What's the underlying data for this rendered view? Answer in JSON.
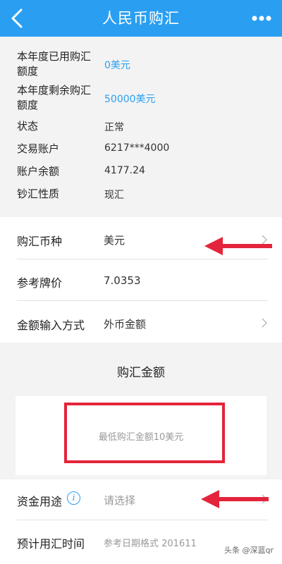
{
  "header": {
    "title": "人民币购汇"
  },
  "info": [
    {
      "label": "本年度已用购汇额度",
      "value": "0美元",
      "highlight": true
    },
    {
      "label": "本年度剩余购汇额度",
      "value": "50000美元",
      "highlight": true
    },
    {
      "label": "状态",
      "value": "正常"
    },
    {
      "label": "交易账户",
      "value": "6217***4000"
    },
    {
      "label": "账户余额",
      "value": "4177.24"
    },
    {
      "label": "钞汇性质",
      "value": "现汇"
    }
  ],
  "form1": {
    "currency_label": "购汇币种",
    "currency_value": "美元",
    "rate_label": "参考牌价",
    "rate_value": "7.0353",
    "input_mode_label": "金额输入方式",
    "input_mode_value": "外币金额"
  },
  "amount": {
    "section_title": "购汇金额",
    "placeholder": "最低购汇金额10美元"
  },
  "form2": {
    "purpose_label": "资金用途",
    "purpose_placeholder": "请选择",
    "time_label": "预计用汇时间",
    "time_placeholder": "参考日期格式 201611"
  },
  "watermark": "头条 @深蓝qr",
  "colors": {
    "accent": "#2a9ff2",
    "annotation": "#e3243b"
  }
}
